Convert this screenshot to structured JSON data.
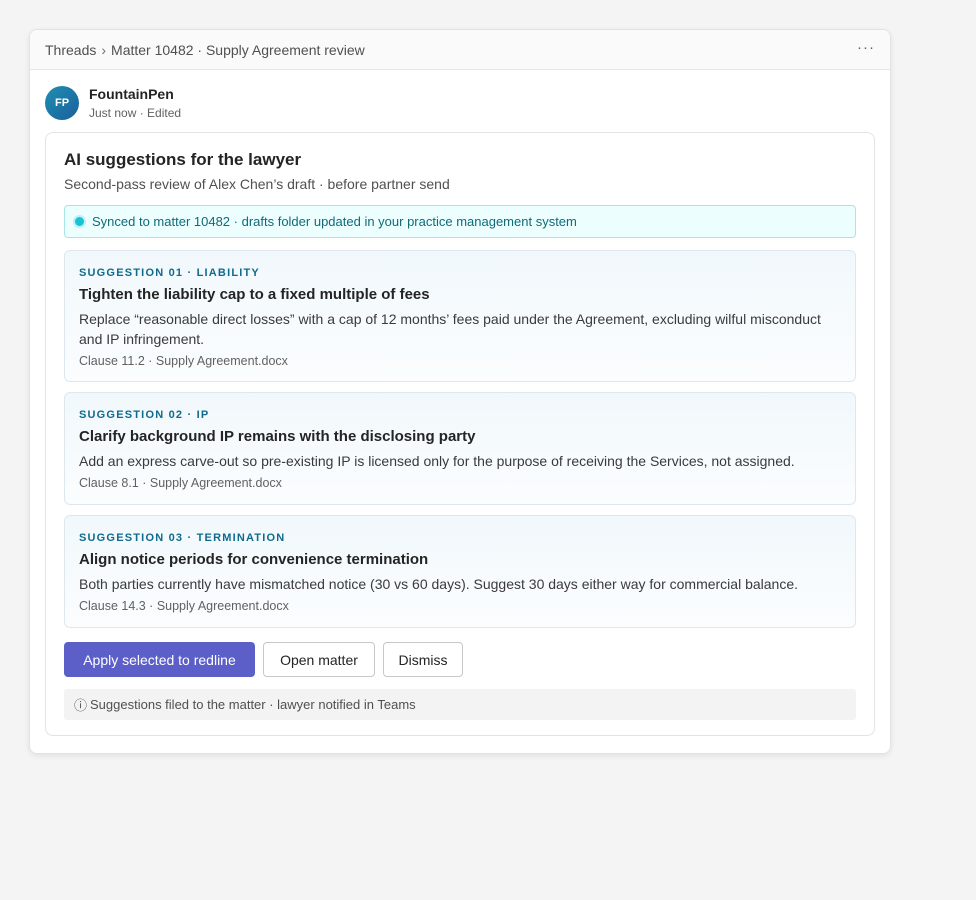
{
  "topbar": {
    "crumbs": [
      "Threads",
      "Matter 10482 · Supply Agreement review"
    ],
    "separator": "›",
    "more_label": "···"
  },
  "message": {
    "avatar_initials": "FP",
    "sender": "FountainPen",
    "meta": "Just now · Edited"
  },
  "card": {
    "title": "AI suggestions for the lawyer",
    "subtitle": "Second-pass review of Alex Chen’s draft · before partner send",
    "sync_text": "Synced to matter 10482 · drafts folder updated in your practice management system",
    "suggestions": [
      {
        "tag": "SUGGESTION 01 · LIABILITY",
        "title": "Tighten the liability cap to a fixed multiple of fees",
        "body": "Replace “reasonable direct losses” with a cap of 12 months’ fees paid under the Agreement, excluding wilful misconduct and IP infringement.",
        "ref": "Clause 11.2 · Supply Agreement.docx"
      },
      {
        "tag": "SUGGESTION 02 · IP",
        "title": "Clarify background IP remains with the disclosing party",
        "body": "Add an express carve-out so pre-existing IP is licensed only for the purpose of receiving the Services, not assigned.",
        "ref": "Clause 8.1 · Supply Agreement.docx"
      },
      {
        "tag": "SUGGESTION 03 · TERMINATION",
        "title": "Align notice periods for convenience termination",
        "body": "Both parties currently have mismatched notice (30 vs 60 days). Suggest 30 days either way for commercial balance.",
        "ref": "Clause 14.3 · Supply Agreement.docx"
      }
    ],
    "actions": {
      "apply_label": "Apply selected to redline",
      "open_label": "Open matter",
      "dismiss_label": "Dismiss"
    },
    "footer_icon": "ⓘ",
    "footer_text": "Suggestions filed to the matter · lawyer notified in Teams"
  },
  "colors": {
    "accent": "#5b5fc7",
    "sync_dot": "#19c2d4",
    "tag": "#0f6b8c"
  },
  "icons": {
    "more": "more-horizontal-icon",
    "info": "info-icon",
    "sync": "status-dot-icon"
  }
}
